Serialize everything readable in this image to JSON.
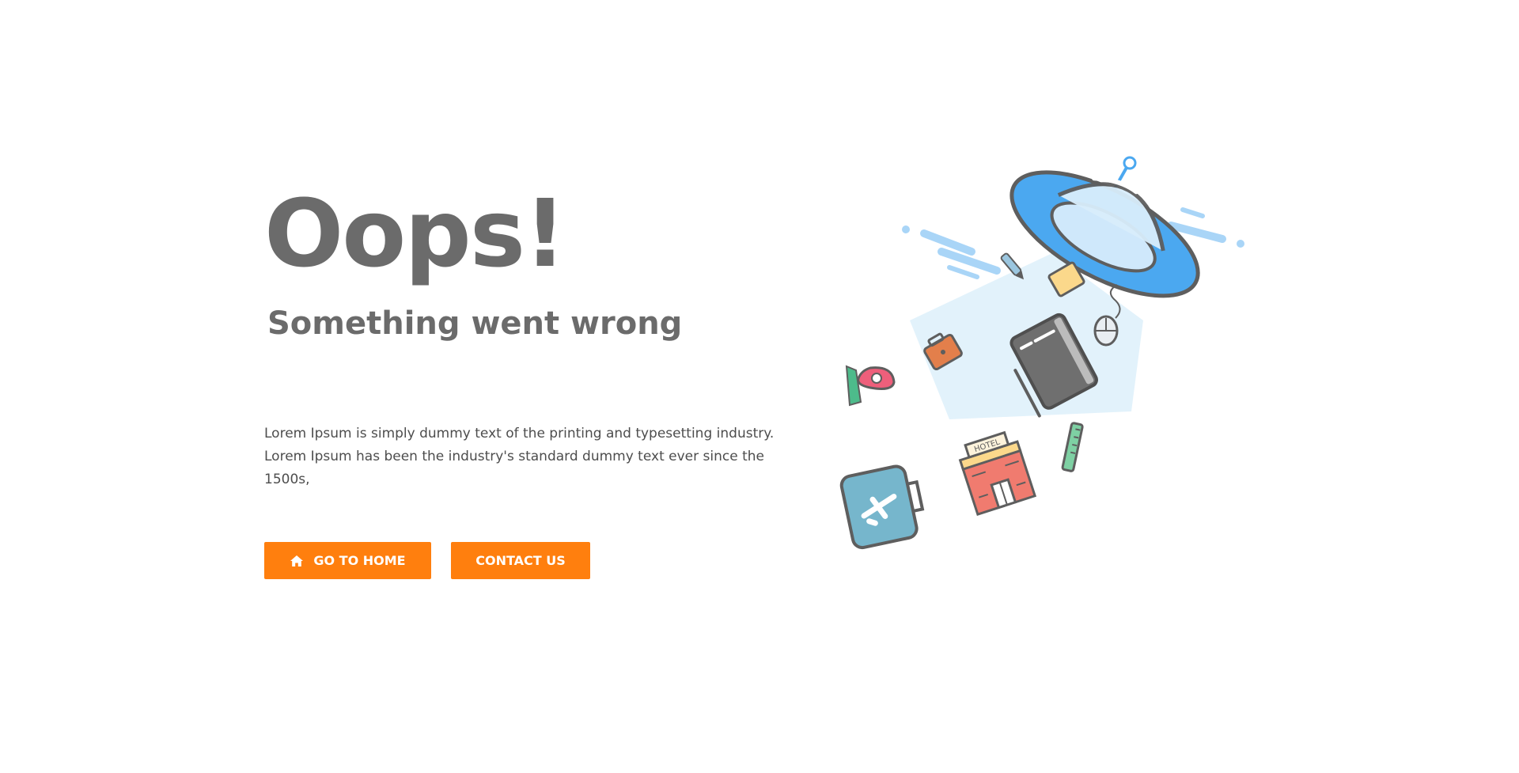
{
  "error": {
    "title": "Oops!",
    "subtitle": "Something went wrong",
    "description": "Lorem Ipsum is simply dummy text of the printing and typesetting industry. Lorem Ipsum has been the industry's standard dummy text ever since the 1500s,"
  },
  "actions": {
    "home_label": "GO TO HOME",
    "contact_label": "CONTACT US",
    "home_icon": "home-icon"
  },
  "illustration": {
    "hotel_sign": "HOTEL"
  },
  "colors": {
    "accent": "#ff7f0e",
    "heading": "#6b6b6b",
    "text": "#4d4d4d",
    "ufo_blue": "#4ba8f0",
    "beam": "#dff1fb"
  }
}
